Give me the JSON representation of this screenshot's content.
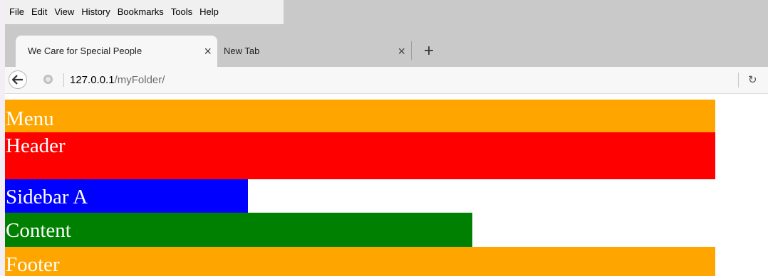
{
  "menubar": {
    "items": [
      {
        "label": "File"
      },
      {
        "label": "Edit"
      },
      {
        "label": "View"
      },
      {
        "label": "History"
      },
      {
        "label": "Bookmarks"
      },
      {
        "label": "Tools"
      },
      {
        "label": "Help"
      }
    ]
  },
  "tabs": [
    {
      "title": "We Care for Special People",
      "active": true,
      "close_icon": "×"
    },
    {
      "title": "New Tab",
      "active": false,
      "close_icon": "×"
    }
  ],
  "new_tab_icon": "+",
  "navbar": {
    "url_host": "127.0.0.1",
    "url_path": "/myFolder/",
    "reload_icon": "↻"
  },
  "page": {
    "blocks": {
      "menu": {
        "label": "Menu",
        "color": "#ffa500"
      },
      "header": {
        "label": "Header",
        "color": "#ff0000"
      },
      "sidebar": {
        "label": "Sidebar A",
        "color": "#0000ff"
      },
      "content": {
        "label": "Content",
        "color": "#008000"
      },
      "footer": {
        "label": "Footer",
        "color": "#ffa500"
      }
    }
  }
}
